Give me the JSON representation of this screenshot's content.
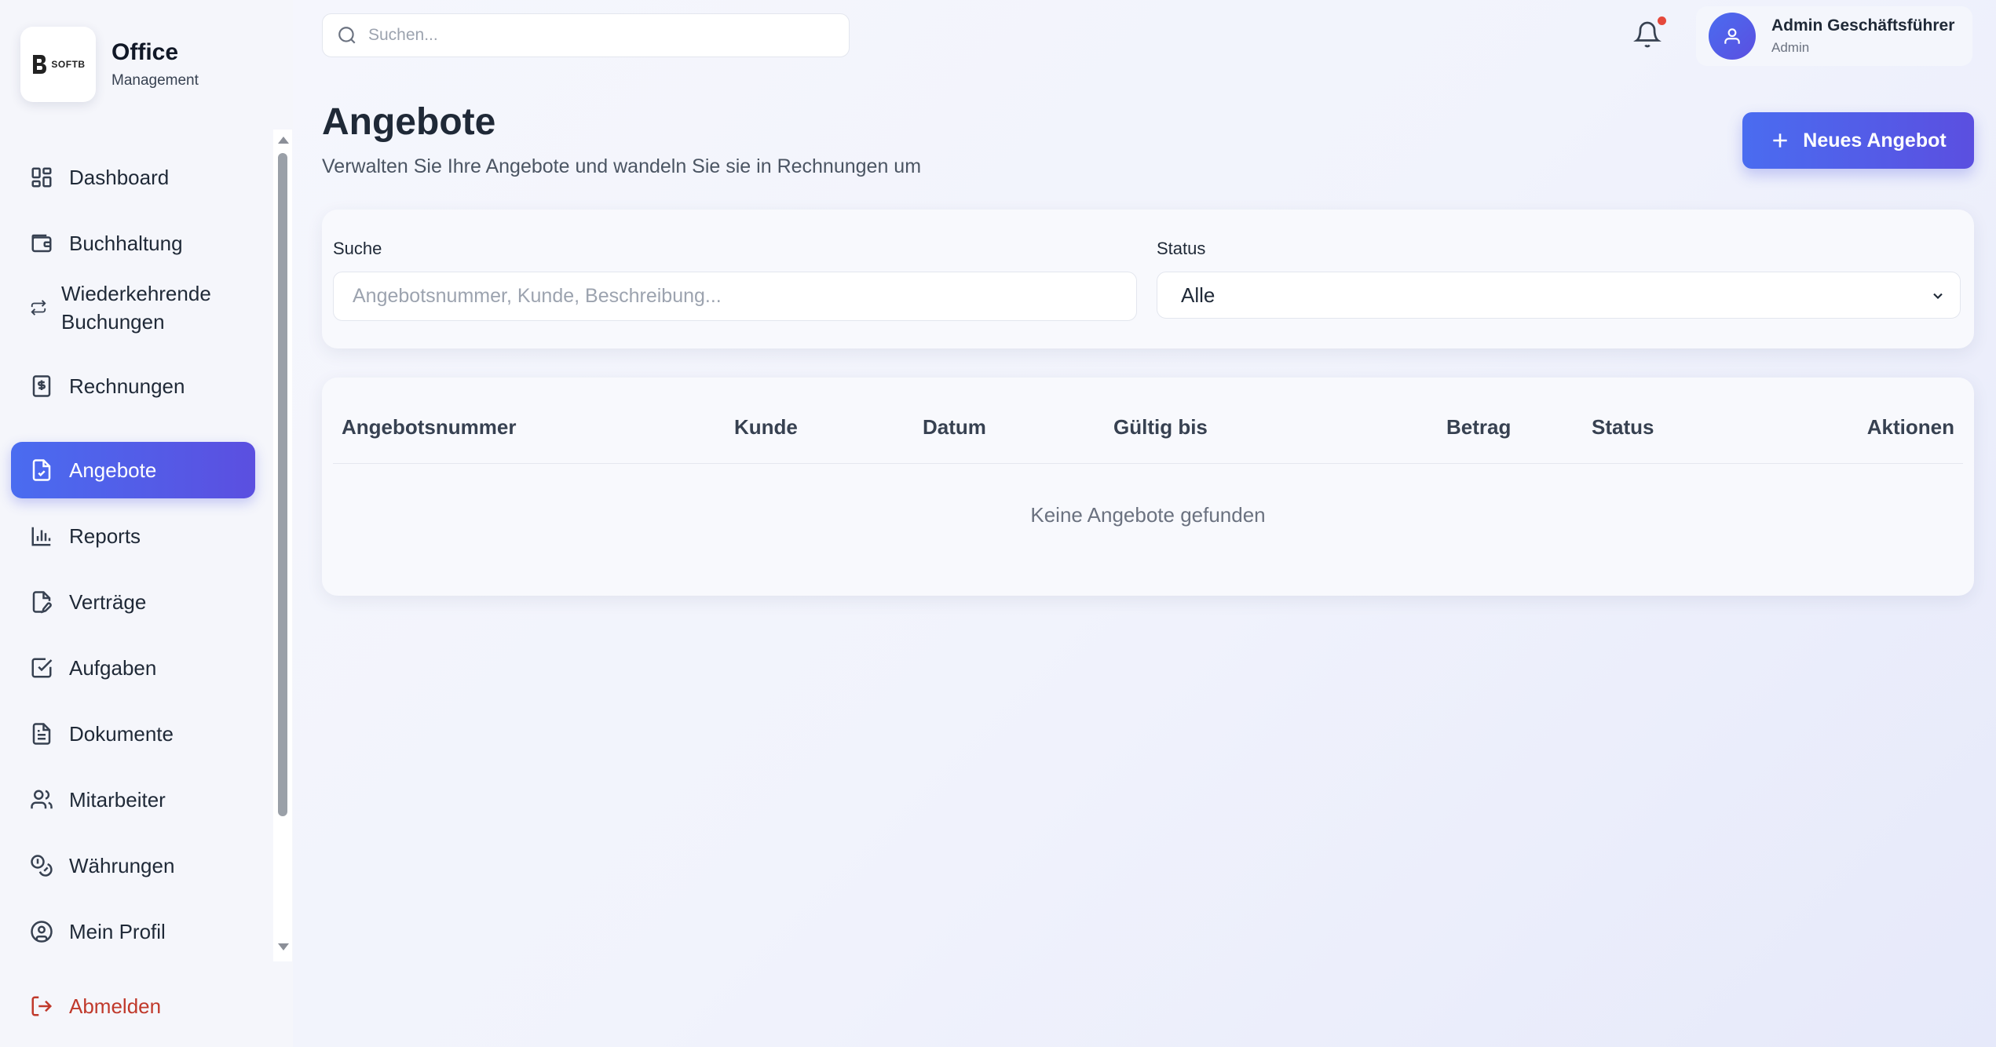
{
  "brand": {
    "logo_text": "SOFTB",
    "title": "Office",
    "subtitle": "Management"
  },
  "topbar": {
    "search_placeholder": "Suchen...",
    "user": {
      "name": "Admin Geschäftsführer",
      "role": "Admin"
    },
    "notification_dot_color": "#e5483b"
  },
  "sidebar": {
    "items": [
      {
        "label": "Dashboard",
        "icon": "grid-icon"
      },
      {
        "label": "Buchhaltung",
        "icon": "wallet-icon"
      },
      {
        "label": "Wiederkehrende Buchungen",
        "icon": "repeat-icon"
      },
      {
        "label": "Rechnungen",
        "icon": "invoice-icon"
      },
      {
        "label": "Angebote",
        "icon": "file-check-icon",
        "active": true
      },
      {
        "label": "Reports",
        "icon": "bar-chart-icon"
      },
      {
        "label": "Verträge",
        "icon": "file-edit-icon"
      },
      {
        "label": "Aufgaben",
        "icon": "check-square-icon"
      },
      {
        "label": "Dokumente",
        "icon": "file-text-icon"
      },
      {
        "label": "Mitarbeiter",
        "icon": "users-icon"
      },
      {
        "label": "Währungen",
        "icon": "coins-icon"
      },
      {
        "label": "Mein Profil",
        "icon": "user-circle-icon"
      }
    ],
    "logout_label": "Abmelden"
  },
  "page": {
    "title": "Angebote",
    "subtitle": "Verwalten Sie Ihre Angebote und wandeln Sie sie in Rechnungen um",
    "new_button_label": "Neues Angebot"
  },
  "filters": {
    "search_label": "Suche",
    "search_placeholder": "Angebotsnummer, Kunde, Beschreibung...",
    "status_label": "Status",
    "status_value": "Alle"
  },
  "table": {
    "columns": [
      "Angebotsnummer",
      "Kunde",
      "Datum",
      "Gültig bis",
      "Betrag",
      "Status",
      "Aktionen"
    ],
    "rows": [],
    "empty_message": "Keine Angebote gefunden"
  },
  "colors": {
    "accent_start": "#4a6cf0",
    "accent_end": "#5b4fe0",
    "logout": "#c0392b"
  }
}
